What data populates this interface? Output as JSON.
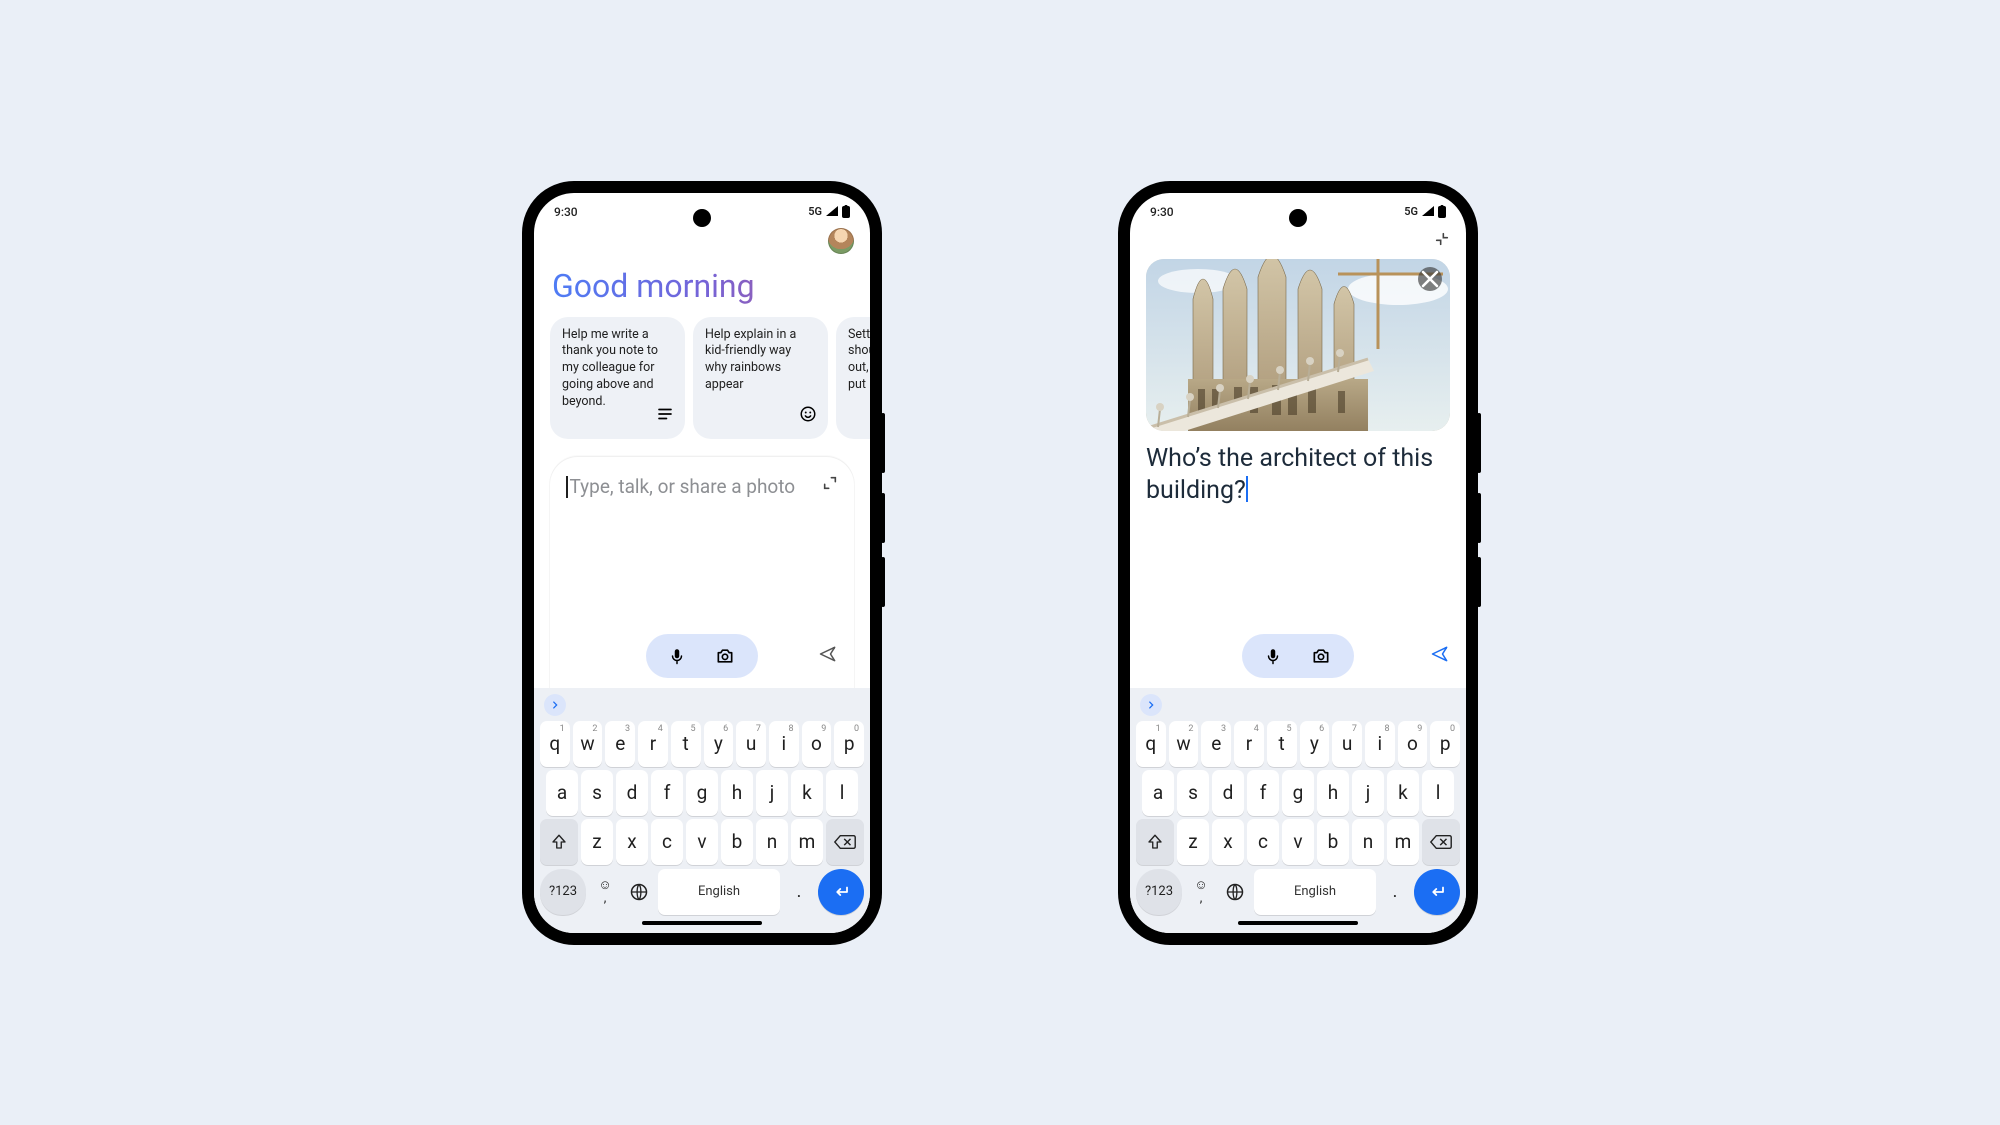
{
  "status": {
    "time": "9:30",
    "net": "5G"
  },
  "phoneA": {
    "greeting": "Good morning",
    "cards": [
      {
        "text": "Help me write a thank you note to my colleague for going above and beyond.",
        "icon_name": "paragraph-icon",
        "glyph": "☰"
      },
      {
        "text": "Help explain in a kid-friendly way why rainbows appear",
        "icon_name": "smile-icon",
        "glyph": "☺"
      },
      {
        "text": "Settle should out, r put in",
        "icon_name": "",
        "glyph": ""
      }
    ],
    "composer": {
      "placeholder": "Type, talk, or share a photo"
    }
  },
  "phoneB": {
    "query": "Who’s the architect of this building?",
    "image_alt": "Photo of an ornate stone cathedral with tall spires under a sky with clouds"
  },
  "keyboard": {
    "row1": [
      {
        "k": "q",
        "n": "1"
      },
      {
        "k": "w",
        "n": "2"
      },
      {
        "k": "e",
        "n": "3"
      },
      {
        "k": "r",
        "n": "4"
      },
      {
        "k": "t",
        "n": "5"
      },
      {
        "k": "y",
        "n": "6"
      },
      {
        "k": "u",
        "n": "7"
      },
      {
        "k": "i",
        "n": "8"
      },
      {
        "k": "o",
        "n": "9"
      },
      {
        "k": "p",
        "n": "0"
      }
    ],
    "row2": [
      "a",
      "s",
      "d",
      "f",
      "g",
      "h",
      "j",
      "k",
      "l"
    ],
    "row3": [
      "z",
      "x",
      "c",
      "v",
      "b",
      "n",
      "m"
    ],
    "numToggle": "?123",
    "space": "English",
    "emoji": "☺",
    "comma": ",",
    "dot": "."
  }
}
